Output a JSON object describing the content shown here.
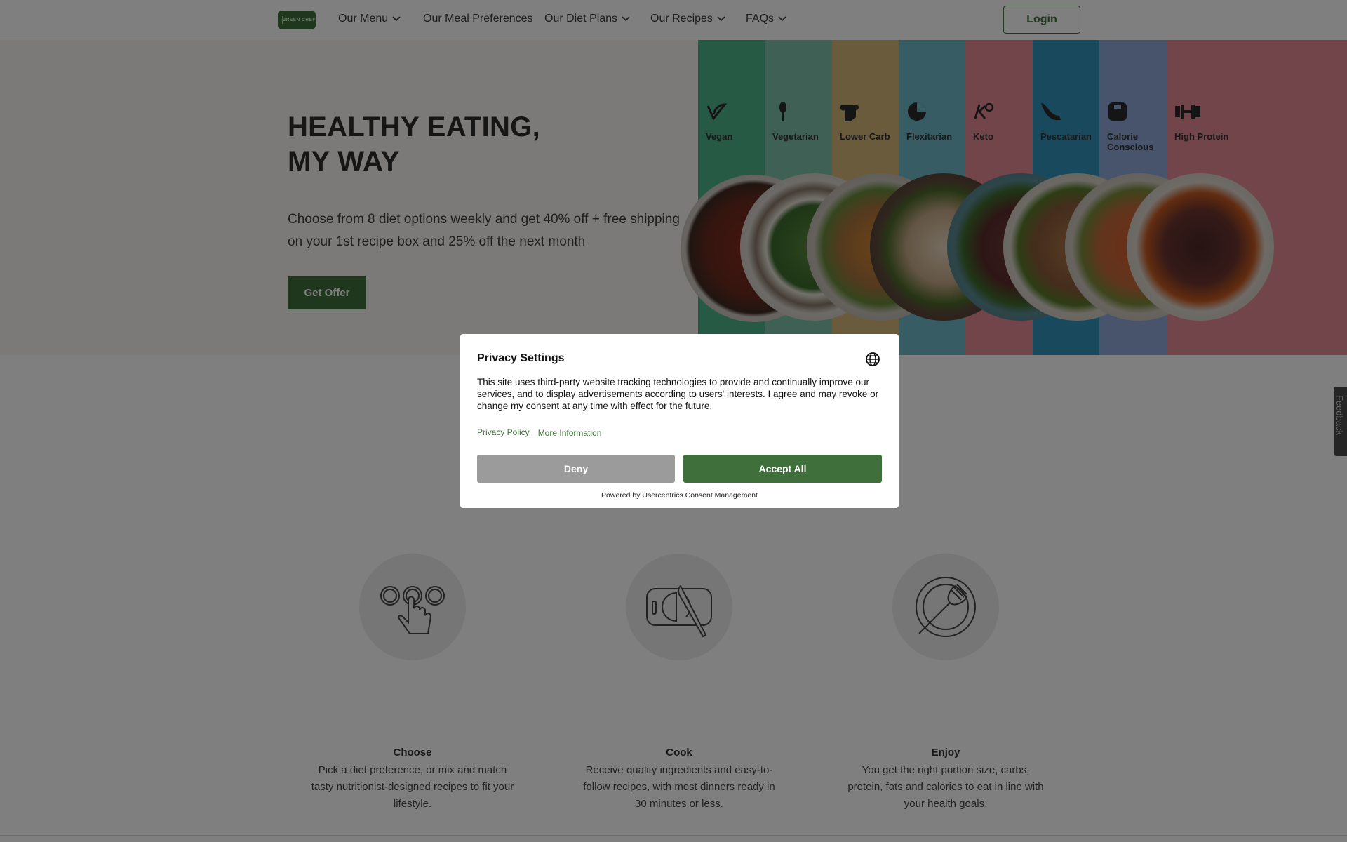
{
  "nav": {
    "logo_text": "GREEN CHEF",
    "items": [
      {
        "label": "Our Menu",
        "has_dropdown": true
      },
      {
        "label": "Our Meal Preferences",
        "has_dropdown": false
      },
      {
        "label": "Our Diet Plans",
        "has_dropdown": true
      },
      {
        "label": "Our Recipes",
        "has_dropdown": true
      },
      {
        "label": "FAQs",
        "has_dropdown": true
      }
    ],
    "login_label": "Login"
  },
  "hero": {
    "title_line1": "HEALTHY EATING,",
    "title_line2": "MY WAY",
    "subtitle": "Choose from 8 diet options weekly and get 40% off + free shipping on your 1st recipe box and 25% off the next month",
    "cta_label": "Get Offer",
    "diets": [
      {
        "label": "Vegan",
        "color": "#4cb48a",
        "icon": "leaf-icon"
      },
      {
        "label": "Vegetarian",
        "color": "#7cc0ab",
        "icon": "wheat-icon"
      },
      {
        "label": "Lower Carb",
        "color": "#d3b676",
        "icon": "bread-icon"
      },
      {
        "label": "Flexitarian",
        "color": "#6fb9c9",
        "icon": "pie-icon"
      },
      {
        "label": "Keto",
        "color": "#e48b97",
        "icon": "keto-icon"
      },
      {
        "label": "Pescatarian",
        "color": "#3393b8",
        "icon": "fish-icon"
      },
      {
        "label": "Calorie Conscious",
        "color": "#91a8d8",
        "icon": "scale-icon"
      },
      {
        "label": "High Protein",
        "color": "#e48b97",
        "icon": "dumbbell-icon"
      }
    ]
  },
  "steps": [
    {
      "title": "Choose",
      "text": "Pick a diet preference, or mix and match tasty nutritionist-designed recipes to fit your lifestyle.",
      "icon": "tap-choose-icon"
    },
    {
      "title": "Cook",
      "text": "Receive quality ingredients and easy-to-follow recipes, with most dinners ready in 30 minutes or less.",
      "icon": "cutting-board-icon"
    },
    {
      "title": "Enjoy",
      "text": "You get the right portion size, carbs, protein, fats and calories to eat in line with your health goals.",
      "icon": "plate-fork-icon"
    }
  ],
  "feedback_label": "Feedback",
  "consent": {
    "title": "Privacy Settings",
    "body": "This site uses third-party website tracking technologies to provide and continually improve our services, and to display advertisements according to users' interests. I agree and may revoke or change my consent at any time with effect for the future.",
    "privacy_policy_link": "Privacy Policy",
    "more_info_link": "More Information",
    "deny_label": "Deny",
    "accept_label": "Accept All",
    "powered_by": "Powered by Usercentrics Consent Management",
    "accent_color": "#3f6f3a"
  },
  "colors": {
    "brand_green": "#3f6f3a",
    "hero_bg": "#f7f5f2",
    "overlay": "rgba(0,0,0,0.5)"
  }
}
